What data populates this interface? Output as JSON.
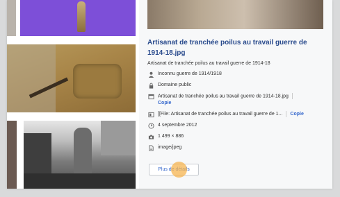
{
  "detail": {
    "title": "Artisanat de tranchée poilus au travail guerre de 1914-18.jpg",
    "description": "Artisanat de tranchée poilus au travail guerre de 1914-18",
    "author": "Inconnu guerre de 1914/1918",
    "license": "Domaine public",
    "filename": "Artisanat de tranchée poilus au travail guerre de 1914-18.jpg",
    "filename_copy": "Copie",
    "wikitext": "[[File: Artisanat de tranchée poilus au travail guerre de 1...",
    "wikitext_copy": "Copie",
    "date": "4 septembre 2012",
    "dimensions": "1 499 × 886",
    "mime": "image/jpeg",
    "more_button": "Plus de détails"
  },
  "icons": {
    "author": "person-icon",
    "license": "lock-icon",
    "filename": "file-icon",
    "wikitext": "embed-icon",
    "date": "clock-icon",
    "dimensions": "camera-icon",
    "mime": "document-icon"
  },
  "colors": {
    "link": "#2a4b8d",
    "accent": "#3366cc",
    "tile_purple": "#7d4fd8"
  }
}
